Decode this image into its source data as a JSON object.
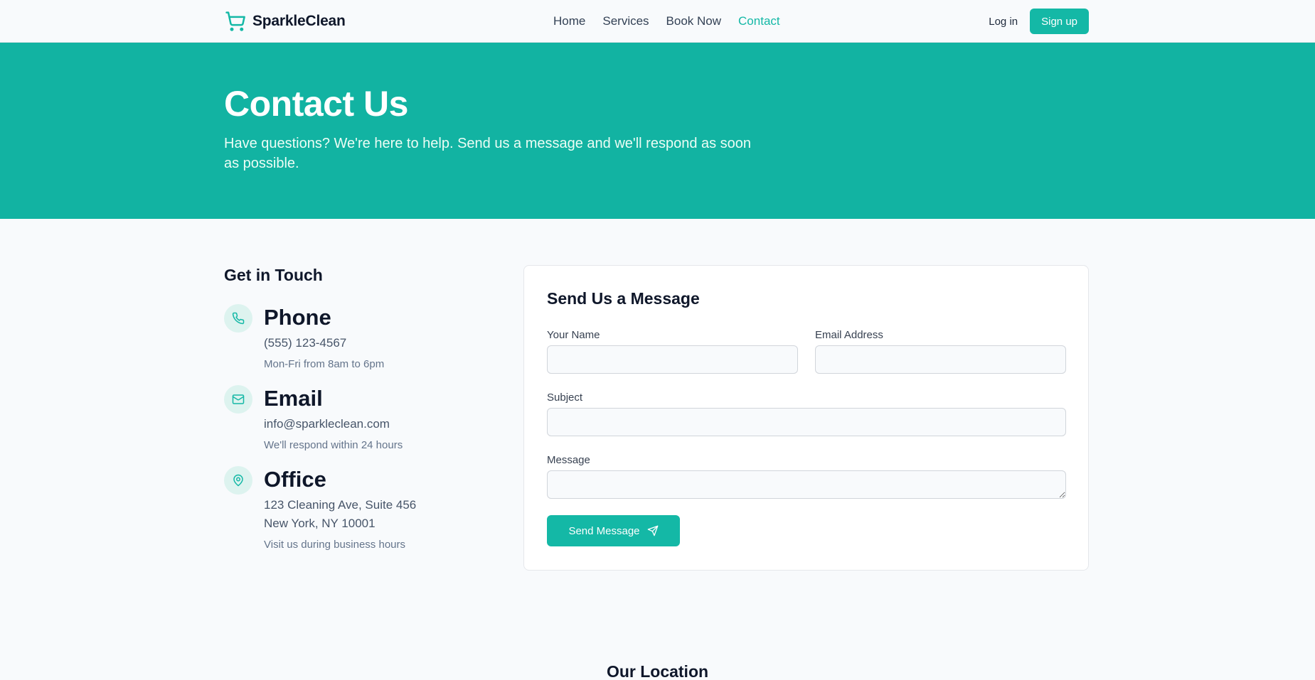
{
  "brand": {
    "name": "SparkleClean",
    "accent": "#14b8a6",
    "hero_bg": "#12b3a2",
    "logo_icon": "shopping-cart-icon"
  },
  "nav": {
    "items": [
      {
        "label": "Home",
        "active": false
      },
      {
        "label": "Services",
        "active": false
      },
      {
        "label": "Book Now",
        "active": false
      },
      {
        "label": "Contact",
        "active": true
      }
    ]
  },
  "auth": {
    "login": "Log in",
    "signup": "Sign up"
  },
  "hero": {
    "title": "Contact Us",
    "subtitle": "Have questions? We're here to help. Send us a message and we'll respond as soon as possible."
  },
  "touch": {
    "title": "Get in Touch",
    "items": [
      {
        "icon": "phone-icon",
        "title": "Phone",
        "lines": [
          "(555) 123-4567"
        ],
        "note": "Mon-Fri from 8am to 6pm"
      },
      {
        "icon": "mail-icon",
        "title": "Email",
        "lines": [
          "info@sparkleclean.com"
        ],
        "note": "We'll respond within 24 hours"
      },
      {
        "icon": "map-pin-icon",
        "title": "Office",
        "lines": [
          "123 Cleaning Ave, Suite 456",
          "New York, NY 10001"
        ],
        "note": "Visit us during business hours"
      }
    ]
  },
  "form": {
    "title": "Send Us a Message",
    "name_label": "Your Name",
    "name_value": "",
    "email_label": "Email Address",
    "email_value": "",
    "subject_label": "Subject",
    "subject_value": "",
    "message_label": "Message",
    "message_value": "",
    "submit": "Send Message",
    "submit_icon": "send-icon"
  },
  "location": {
    "title": "Our Location"
  }
}
